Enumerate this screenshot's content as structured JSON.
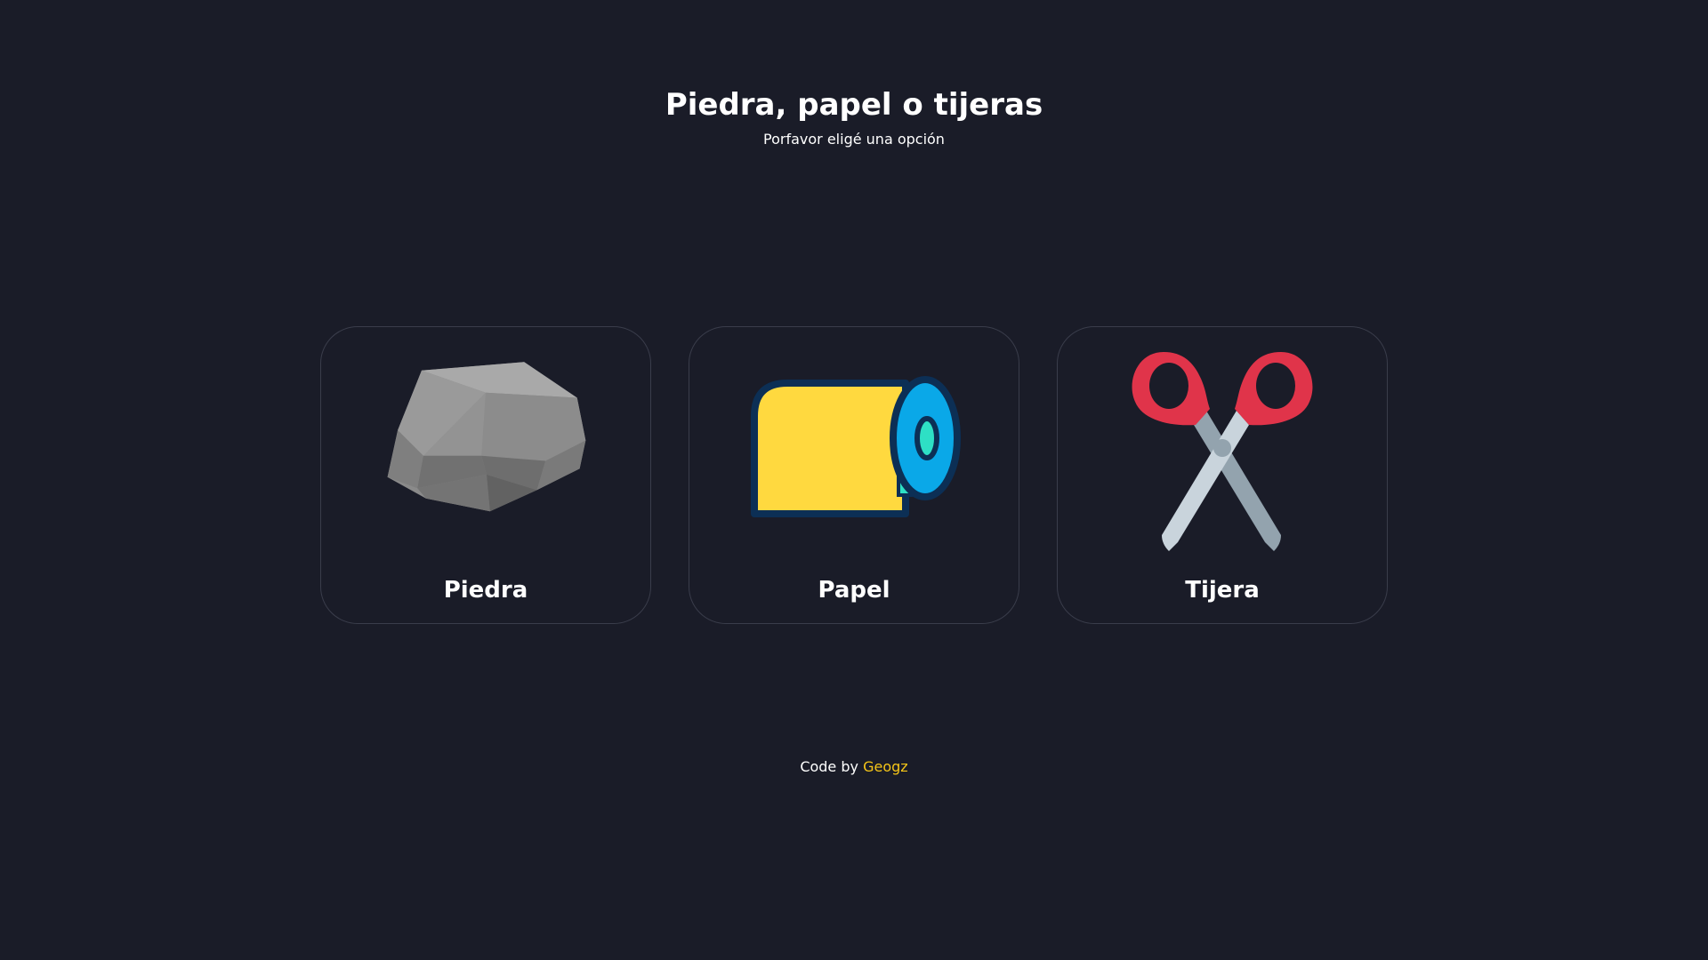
{
  "header": {
    "title": "Piedra, papel o tijeras",
    "subtitle": "Porfavor eligé una opción"
  },
  "options": [
    {
      "label": "Piedra",
      "icon": "rock-icon"
    },
    {
      "label": "Papel",
      "icon": "paper-roll-icon"
    },
    {
      "label": "Tijera",
      "icon": "scissors-icon"
    }
  ],
  "footer": {
    "prefix": "Code by",
    "author": "Geogz"
  },
  "colors": {
    "background": "#1a1c28",
    "card_border": "#3a3d4b",
    "accent": "#f5c518",
    "text": "#ffffff"
  }
}
